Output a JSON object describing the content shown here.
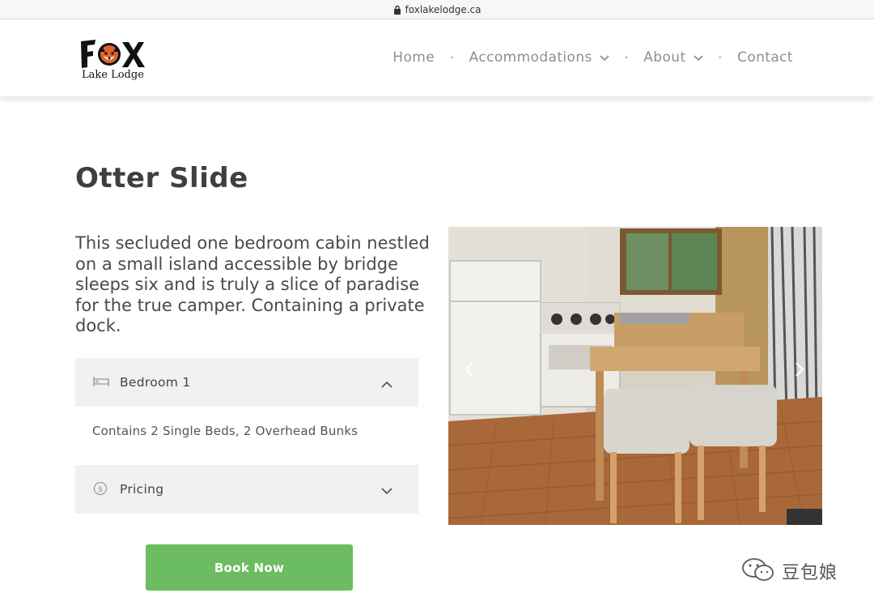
{
  "browser": {
    "url": "foxlakelodge.ca"
  },
  "logo": {
    "main": "FOX",
    "sub": "Lake Lodge"
  },
  "nav": {
    "items": [
      {
        "label": "Home"
      },
      {
        "label": "Accommodations"
      },
      {
        "label": "About"
      },
      {
        "label": "Contact"
      }
    ],
    "separator": "•"
  },
  "page": {
    "title": "Otter Slide",
    "description": "This secluded one bedroom cabin nestled on a small island accessible by bridge sleeps six and is truly a slice of paradise for the true camper. Containing a private dock."
  },
  "accordion": {
    "bedroom": {
      "label": "Bedroom 1",
      "icon": "bed-icon",
      "expanded": true,
      "content": "Contains 2 Single Beds, 2 Overhead Bunks"
    },
    "pricing": {
      "label": "Pricing",
      "icon": "dollar-icon",
      "expanded": false
    }
  },
  "cta": {
    "book_label": "Book Now"
  },
  "carousel": {
    "prev_icon": "chevron-left-icon",
    "next_icon": "chevron-right-icon"
  },
  "watermark": {
    "text": "豆包娘"
  },
  "colors": {
    "accent_green": "#6cbc62",
    "logo_orange": "#e0632a",
    "accordion_bg": "#f1f1f1"
  }
}
